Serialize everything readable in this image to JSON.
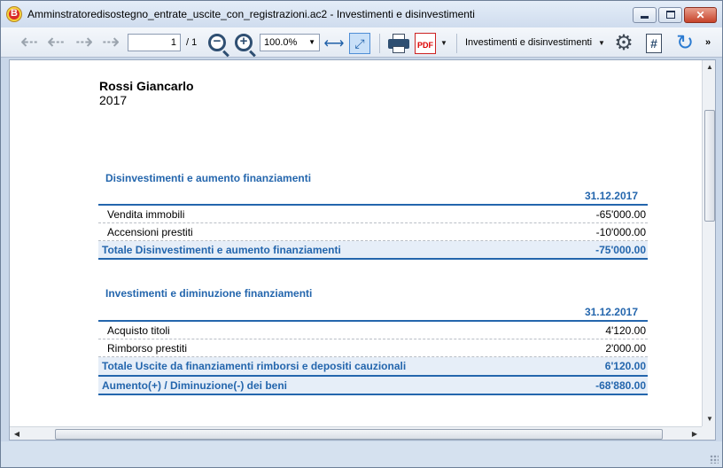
{
  "window": {
    "title": "Amminstratoredisostegno_entrate_uscite_con_registrazioni.ac2 - Investimenti e disinvestimenti",
    "app_icon_letter": "B",
    "minimize_glyph": "",
    "maximize_glyph": "",
    "close_glyph": "✕"
  },
  "toolbar": {
    "page_current": "1",
    "page_total": "/ 1",
    "zoom": "100.0%",
    "report_name": "Investimenti e disinvestimenti",
    "pdf_label": "PDF",
    "hash_label": "#",
    "more_label": "»"
  },
  "report": {
    "author": "Rossi Giancarlo",
    "year": "2017",
    "section1": {
      "title": "Disinvestimenti e aumento finanziamenti",
      "date": "31.12.2017",
      "rows": [
        {
          "label": "Vendita immobili",
          "value": "-65'000.00"
        },
        {
          "label": "Accensioni prestiti",
          "value": "-10'000.00"
        }
      ],
      "total_label": "Totale Disinvestimenti e aumento finanziamenti",
      "total_value": "-75'000.00"
    },
    "section2": {
      "title": "Investimenti e diminuzione finanziamenti",
      "date": "31.12.2017",
      "rows": [
        {
          "label": "Acquisto titoli",
          "value": "4'120.00"
        },
        {
          "label": "Rimborso prestiti",
          "value": "2'000.00"
        }
      ],
      "total_label": "Totale Uscite da finanziamenti rimborsi e depositi cauzionali",
      "total_value": "6'120.00",
      "grand_label": "Aumento(+) / Diminuzione(-) dei beni",
      "grand_value": "-68'880.00"
    }
  },
  "colors": {
    "accent": "#2466ad",
    "total_bg": "#e6eef8"
  },
  "icons": [
    "app-logo-icon",
    "back-icon",
    "previous-page-icon",
    "next-page-icon",
    "forward-icon",
    "zoom-out-icon",
    "zoom-in-icon",
    "fit-width-icon",
    "fit-page-icon",
    "print-icon",
    "pdf-icon",
    "gear-icon",
    "hash-icon",
    "refresh-icon"
  ]
}
